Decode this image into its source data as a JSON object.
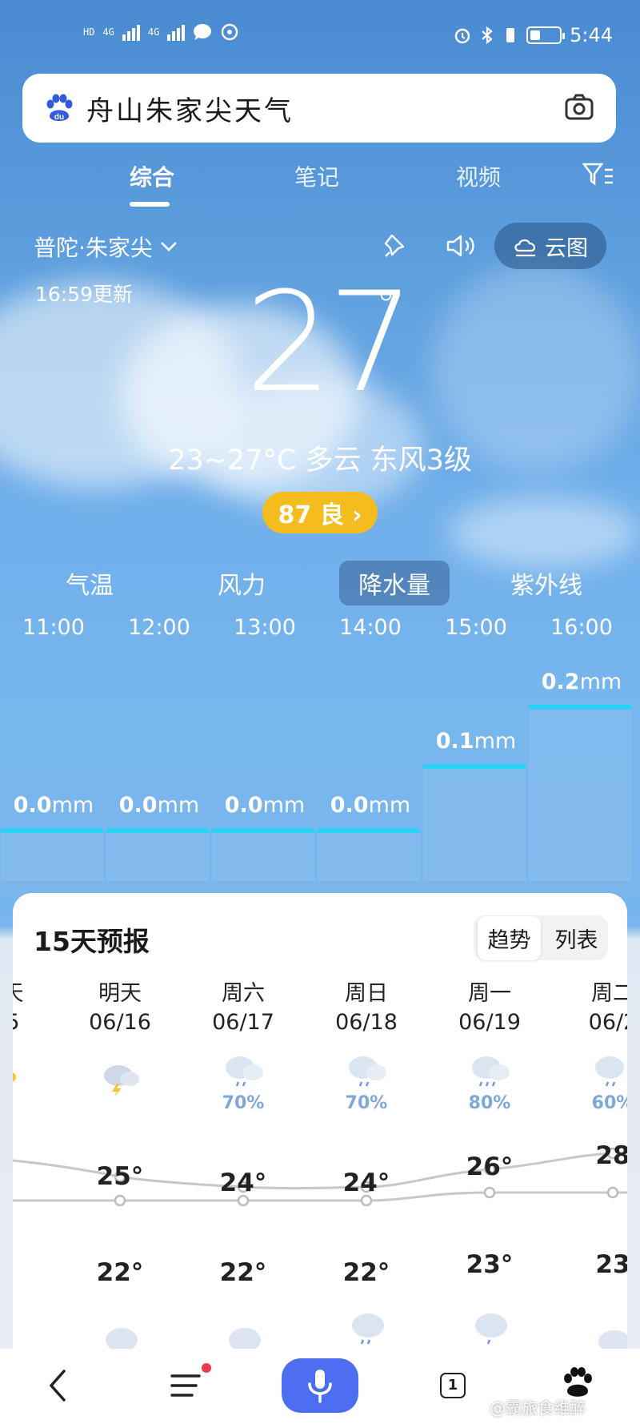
{
  "status_bar": {
    "left_labels": [
      "HD",
      "HD",
      "4G",
      "4G"
    ],
    "time": "5:44"
  },
  "search": {
    "query": "舟山朱家尖天气"
  },
  "tabs": [
    {
      "label": "综合"
    },
    {
      "label": "笔记"
    },
    {
      "label": "视频"
    }
  ],
  "location": {
    "name": "普陀·朱家尖",
    "cloud_map_label": "云图",
    "updated": "16:59更新"
  },
  "current": {
    "temp": "27",
    "degree_symbol": "°",
    "summary": "23~27°C 多云 东风3级",
    "aqi": "87 良 ›"
  },
  "metric_tabs": [
    "气温",
    "风力",
    "降水量",
    "紫外线"
  ],
  "hourly": {
    "hours": [
      "11:00",
      "12:00",
      "13:00",
      "14:00",
      "15:00",
      "16:00"
    ],
    "precip_mm": [
      0.0,
      0.0,
      0.0,
      0.0,
      0.1,
      0.2
    ],
    "labels": [
      "0.0",
      "0.0",
      "0.0",
      "0.0",
      "0.1",
      "0.2"
    ],
    "unit": "mm",
    "accent_color": "#27d2f6"
  },
  "forecast": {
    "title": "15天预报",
    "toggle": [
      "趋势",
      "列表"
    ],
    "days": [
      {
        "label": "天",
        "date": "5",
        "precip": "",
        "high": "",
        "low": ""
      },
      {
        "label": "明天",
        "date": "06/16",
        "precip": "",
        "high": "25°",
        "low": "22°"
      },
      {
        "label": "周六",
        "date": "06/17",
        "precip": "70%",
        "high": "24°",
        "low": "22°"
      },
      {
        "label": "周日",
        "date": "06/18",
        "precip": "70%",
        "high": "24°",
        "low": "22°"
      },
      {
        "label": "周一",
        "date": "06/19",
        "precip": "80%",
        "high": "26°",
        "low": "23°"
      },
      {
        "label": "周二",
        "date": "06/2",
        "precip": "60%",
        "high": "28",
        "low": "23"
      }
    ]
  },
  "watermark": "@霸旅食维醉",
  "tab_count": "1"
}
